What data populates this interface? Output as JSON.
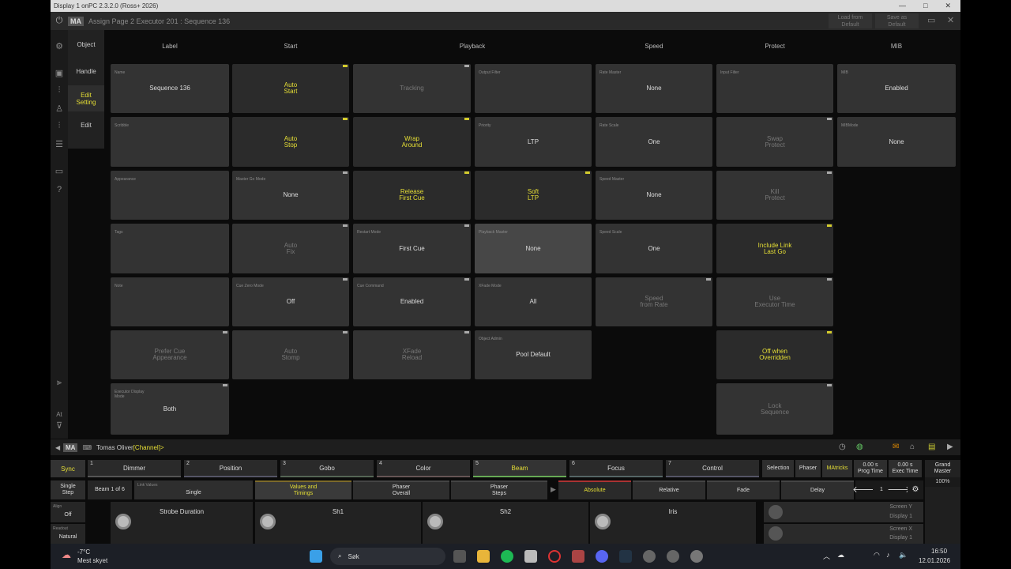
{
  "window": {
    "title": "Display 1 onPC 2.3.2.0 (Ross+ 2026)",
    "controls": [
      "—",
      "□",
      "✕"
    ]
  },
  "titlebar": {
    "logo": "MA",
    "title": "Assign Page 2 Executor 201 : Sequence 136",
    "load_default": "Load from\nDefault",
    "save_default": "Save as\nDefault"
  },
  "sidetabs": {
    "object": "Object",
    "handle": "Handle",
    "edit_setting": "Edit\nSetting",
    "edit": "Edit"
  },
  "columns": [
    "Label",
    "Start",
    "Playback",
    "Speed",
    "Protect",
    "MIB"
  ],
  "cells": {
    "name": {
      "label": "Name",
      "value": "Sequence 136"
    },
    "scribble": {
      "label": "Scribble",
      "value": ""
    },
    "appearance": {
      "label": "Appearance",
      "value": ""
    },
    "tags": {
      "label": "Tags",
      "value": ""
    },
    "note": {
      "label": "Note",
      "value": ""
    },
    "prefer_cue_appearance": {
      "label": "",
      "value": "Prefer Cue\nAppearance"
    },
    "executor_display_mode": {
      "label": "Executor Display\nMode",
      "value": "Both"
    },
    "auto_start": {
      "label": "",
      "value": "Auto\nStart"
    },
    "auto_stop": {
      "label": "",
      "value": "Auto\nStop"
    },
    "master_go_mode": {
      "label": "Master Go Mode",
      "value": "None"
    },
    "auto_fix": {
      "label": "",
      "value": "Auto\nFix"
    },
    "cue_zero_mode": {
      "label": "Cue Zero Mode",
      "value": "Off"
    },
    "auto_stomp": {
      "label": "",
      "value": "Auto\nStomp"
    },
    "tracking": {
      "label": "",
      "value": "Tracking"
    },
    "wrap_around": {
      "label": "",
      "value": "Wrap\nAround"
    },
    "release_first_cue": {
      "label": "",
      "value": "Release\nFirst Cue"
    },
    "restart_mode": {
      "label": "Restart Mode",
      "value": "First Cue"
    },
    "cue_command": {
      "label": "Cue Command",
      "value": "Enabled"
    },
    "xfade_reload": {
      "label": "",
      "value": "XFade\nReload"
    },
    "output_filter": {
      "label": "Output Filter",
      "value": ""
    },
    "priority": {
      "label": "Priority",
      "value": "LTP"
    },
    "soft_ltp": {
      "label": "",
      "value": "Soft\nLTP"
    },
    "playback_master": {
      "label": "Playback Master",
      "value": "None"
    },
    "xfade_mode": {
      "label": "XFade Mode",
      "value": "All"
    },
    "object_admin": {
      "label": "Object Admin",
      "value": "Pool Default"
    },
    "rate_master": {
      "label": "Rate Master",
      "value": "None"
    },
    "rate_scale": {
      "label": "Rate Scale",
      "value": "One"
    },
    "speed_master": {
      "label": "Speed Master",
      "value": "None"
    },
    "speed_scale": {
      "label": "Speed Scale",
      "value": "One"
    },
    "speed_from_rate": {
      "label": "",
      "value": "Speed\nfrom Rate"
    },
    "input_filter": {
      "label": "Input Filter",
      "value": ""
    },
    "swap_protect": {
      "label": "",
      "value": "Swap\nProtect"
    },
    "kill_protect": {
      "label": "",
      "value": "Kill\nProtect"
    },
    "include_link_last_go": {
      "label": "",
      "value": "Include Link\nLast Go"
    },
    "use_executor_time": {
      "label": "",
      "value": "Use\nExecutor Time"
    },
    "off_when_overridden": {
      "label": "",
      "value": "Off when\nOverridden"
    },
    "lock_sequence": {
      "label": "",
      "value": "Lock\nSequence"
    },
    "mib": {
      "label": "MIB",
      "value": "Enabled"
    },
    "mib_mode": {
      "label": "MIBMode",
      "value": "None"
    }
  },
  "cmdline": {
    "logo": "MA",
    "user": "Tomas Oliver",
    "prompt": "[Channel]>"
  },
  "presets": [
    {
      "num": "",
      "label": "Sync"
    },
    {
      "num": "1",
      "label": "Dimmer"
    },
    {
      "num": "2",
      "label": "Position"
    },
    {
      "num": "3",
      "label": "Gobo"
    },
    {
      "num": "4",
      "label": "Color"
    },
    {
      "num": "5",
      "label": "Beam"
    },
    {
      "num": "6",
      "label": "Focus"
    },
    {
      "num": "7",
      "label": "Control"
    }
  ],
  "right_buttons": {
    "selection": "Selection",
    "phaser": "Phaser",
    "matricks": "MAtricks",
    "prog_time": "0.00 s\nProg Time",
    "exec_time": "0.00 s\nExec Time",
    "grand_master": "Grand\nMaster",
    "gm_value": "100%"
  },
  "row2": {
    "single_step": "Single\nStep",
    "beam_page": "Beam 1 of 6",
    "link_values_label": "Link Values",
    "link_values": "Single",
    "values_timings": "Values and\nTimings",
    "phaser_overall": "Phaser\nOverall",
    "phaser_steps": "Phaser\nSteps",
    "absolute": "Absolute",
    "relative": "Relative",
    "fade": "Fade",
    "delay": "Delay",
    "page": "1"
  },
  "row3": {
    "align_label": "Align",
    "align": "Off",
    "readout_label": "Readout",
    "readout": "Natural",
    "encoders": [
      "Strobe Duration",
      "Sh1",
      "Sh2",
      "Iris"
    ],
    "screen_y": "Screen Y",
    "display_y": "Display 1",
    "screen_x": "Screen X",
    "display_x": "Display 1"
  },
  "taskbar": {
    "temp": "-7°C",
    "weather": "Mest skyet",
    "search": "Søk",
    "time": "16:50",
    "date": "12.01.2026"
  }
}
